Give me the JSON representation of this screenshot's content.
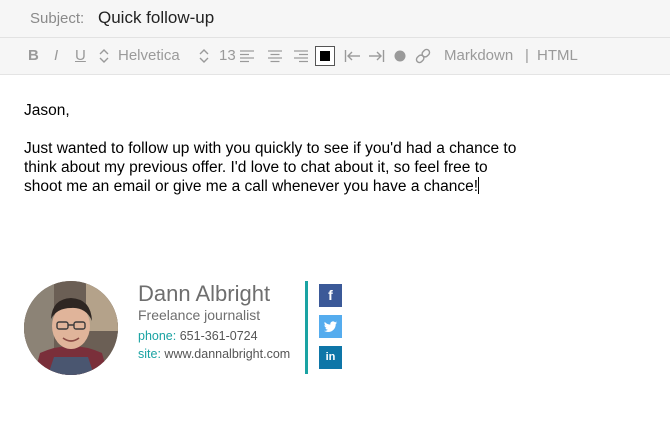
{
  "header": {
    "subject_label": "Subject:",
    "subject_value": "Quick follow-up"
  },
  "toolbar": {
    "bold": "B",
    "italic": "I",
    "underline": "U",
    "font_name": "Helvetica",
    "font_size": "13",
    "markdown": "Markdown",
    "divider": "|",
    "html": "HTML",
    "text_color": "#000000"
  },
  "message": {
    "greeting": "Jason,",
    "line1": "Just wanted to follow up with you quickly to see if you'd had a chance to",
    "line2": "think about my previous offer. I'd love to chat about it, so feel free to",
    "line3": "shoot me an email or give me a call whenever you have a chance!"
  },
  "signature": {
    "name": "Dann Albright",
    "title": "Freelance journalist",
    "phone_label": "phone:",
    "phone": "651-361-0724",
    "site_label": "site:",
    "site": "www.dannalbright.com",
    "accent_color": "#1aa3a3",
    "social": [
      {
        "icon": "facebook-icon",
        "glyph": "f",
        "color": "#3b5998"
      },
      {
        "icon": "twitter-icon",
        "glyph": "t",
        "color": "#55acee"
      },
      {
        "icon": "linkedin-icon",
        "glyph": "in",
        "color": "#0e76a8"
      }
    ]
  }
}
